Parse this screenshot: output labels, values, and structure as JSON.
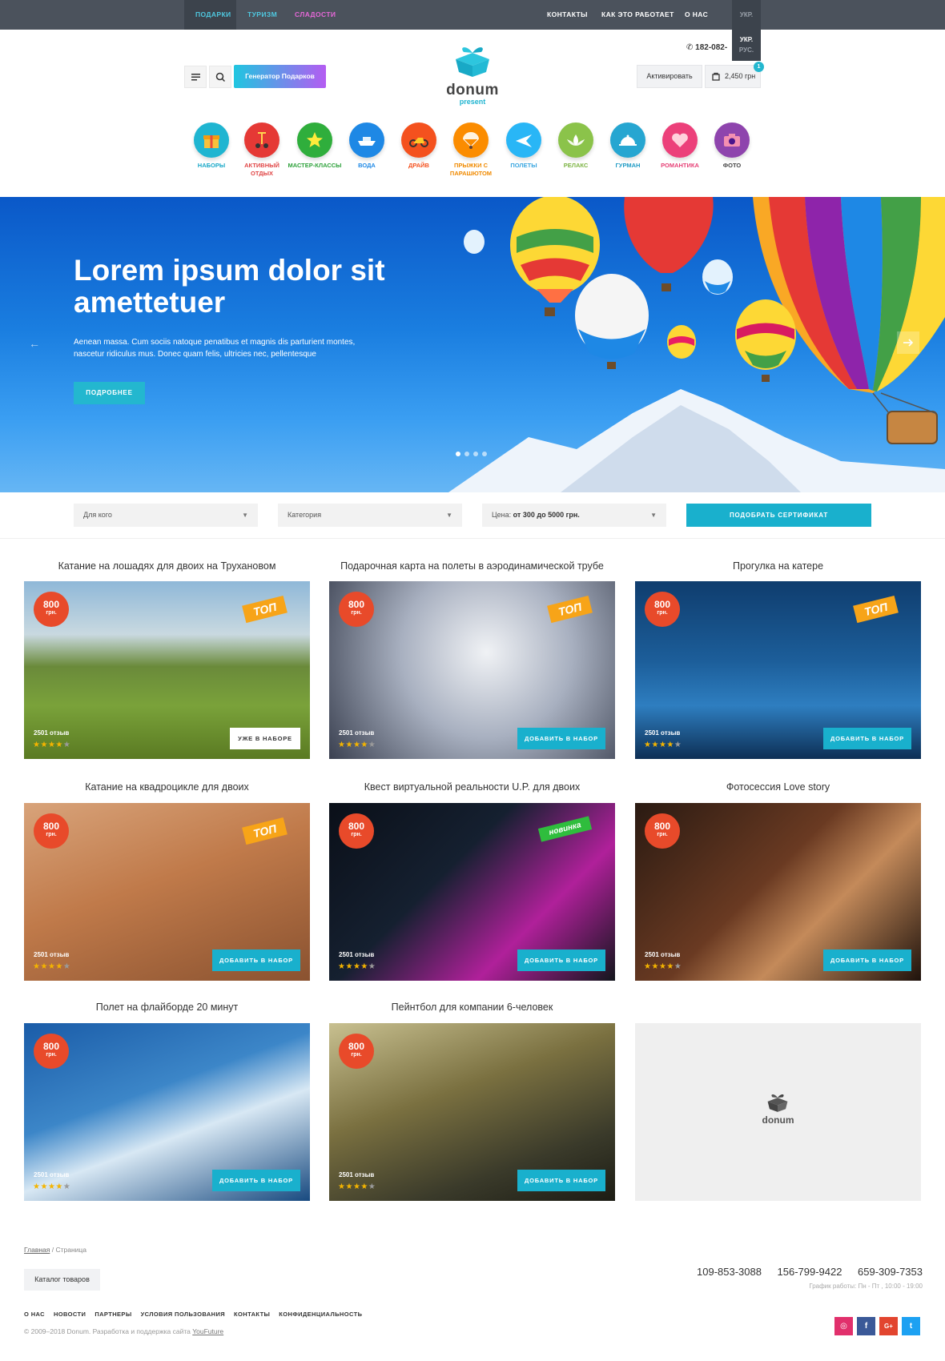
{
  "topnav": {
    "left": [
      "ПОДАРКИ",
      "ТУРИЗМ",
      "СЛАДОСТИ"
    ],
    "right": [
      "КОНТАКТЫ",
      "КАК ЭТО РАБОТАЕТ",
      "О НАС"
    ],
    "lang_current": "УКР.",
    "lang_options": [
      "УКР.",
      "РУС."
    ],
    "colors": {
      "bar": "#4b525c",
      "gifts": "#4fc8e0",
      "tourism": "#4fc8e0",
      "sweets": "#e668d8"
    }
  },
  "header": {
    "generator_label": "Генератор Подарков",
    "logo_word": "donum",
    "logo_sub": "present",
    "phone": "182-082-",
    "activate_label": "Активировать",
    "cart_total": "2,450 грн",
    "cart_count": "1"
  },
  "categories": [
    {
      "label": "НАБОРЫ",
      "color": "#1fb5d1",
      "text_color": "#19a8c8",
      "icon": "gift-icon"
    },
    {
      "label": "АКТИВНЫЙ ОТДЫХ",
      "color": "#e53935",
      "text_color": "#e04545",
      "icon": "segway-icon"
    },
    {
      "label": "МАСТЕР-КЛАССЫ",
      "color": "#2fae3c",
      "text_color": "#2fa23c",
      "icon": "star-icon"
    },
    {
      "label": "ВОДА",
      "color": "#1e88e5",
      "text_color": "#1e88e5",
      "icon": "boat-icon"
    },
    {
      "label": "ДРАЙВ",
      "color": "#f4511e",
      "text_color": "#f4511e",
      "icon": "motorbike-icon"
    },
    {
      "label": "ПРЫЖКИ С ПАРАШЮТОМ",
      "color": "#fb8c00",
      "text_color": "#f08a00",
      "icon": "parachute-icon"
    },
    {
      "label": "ПОЛЕТЫ",
      "color": "#29b6f6",
      "text_color": "#3aa6e0",
      "icon": "plane-icon"
    },
    {
      "label": "РЕЛАКС",
      "color": "#8bc34a",
      "text_color": "#7cb342",
      "icon": "lotus-icon"
    },
    {
      "label": "ГУРМАН",
      "color": "#26a6d1",
      "text_color": "#1e9ac4",
      "icon": "cloche-icon"
    },
    {
      "label": "РОМАНТИКА",
      "color": "#ec407a",
      "text_color": "#e64076",
      "icon": "heart-icon"
    },
    {
      "label": "ФОТО",
      "color": "#8e44ad",
      "text_color": "#444444",
      "icon": "camera-icon"
    }
  ],
  "hero": {
    "title": "Lorem ipsum dolor sit amettetuer",
    "text": "Aenean massa. Cum sociis natoque penatibus et magnis dis parturient montes, nascetur ridiculus mus. Donec quam felis, ultricies nec, pellentesque",
    "button": "ПОДРОБНЕЕ",
    "slides": 4,
    "active_slide": 1
  },
  "filters": {
    "who": "Для кого",
    "category": "Категория",
    "price_label": "Цена:",
    "price_value": "от 300 до 5000 грн.",
    "submit": "ПОДОБРАТЬ СЕРТИФИКАТ"
  },
  "products": [
    {
      "title": "Катание на лошадях для двоих на Трухановом",
      "price": "800",
      "currency": "грн.",
      "tag": "ТОП",
      "tag_type": "top",
      "reviews": "2501 отзыв",
      "rating": 4,
      "button": "УЖЕ В НАБОРЕ",
      "in_set": true,
      "scene": "horses"
    },
    {
      "title": "Подарочная карта на полеты в аэродинамической трубе",
      "price": "800",
      "currency": "грн.",
      "tag": "ТОП",
      "tag_type": "top",
      "reviews": "2501 отзыв",
      "rating": 4,
      "button": "ДОБАВИТЬ В НАБОР",
      "in_set": false,
      "scene": "tunnel"
    },
    {
      "title": "Прогулка на катере",
      "price": "800",
      "currency": "грн.",
      "tag": "ТОП",
      "tag_type": "top",
      "reviews": "2501 отзыв",
      "rating": 4,
      "button": "ДОБАВИТЬ В НАБОР",
      "in_set": false,
      "scene": "boat"
    },
    {
      "title": "Катание на квадроцикле для двоих",
      "price": "800",
      "currency": "грн.",
      "tag": "ТОП",
      "tag_type": "top",
      "reviews": "2501 отзыв",
      "rating": 4,
      "button": "ДОБАВИТЬ В НАБОР",
      "in_set": false,
      "scene": "quad"
    },
    {
      "title": "Квест виртуальной реальности U.P. для двоих",
      "price": "800",
      "currency": "грн.",
      "tag": "НОВИНКА",
      "tag_type": "new",
      "reviews": "2501 отзыв",
      "rating": 4,
      "button": "ДОБАВИТЬ В НАБОР",
      "in_set": false,
      "scene": "vr"
    },
    {
      "title": "Фотосессия Love story",
      "price": "800",
      "currency": "грн.",
      "tag": "",
      "tag_type": "",
      "reviews": "2501 отзыв",
      "rating": 4,
      "button": "ДОБАВИТЬ В НАБОР",
      "in_set": false,
      "scene": "couple"
    },
    {
      "title": "Полет на флайборде 20 минут",
      "price": "800",
      "currency": "грн.",
      "tag": "",
      "tag_type": "",
      "reviews": "2501 отзыв",
      "rating": 4,
      "button": "ДОБАВИТЬ В НАБОР",
      "in_set": false,
      "scene": "flyboard"
    },
    {
      "title": "Пейнтбол для компании 6-человек",
      "price": "800",
      "currency": "грн.",
      "tag": "",
      "tag_type": "",
      "reviews": "2501 отзыв",
      "rating": 4,
      "button": "ДОБАВИТЬ В НАБОР",
      "in_set": false,
      "scene": "paintball"
    }
  ],
  "placeholder_logo": "donum",
  "footer": {
    "breadcrumb_home": "Главная",
    "breadcrumb_sep": " / ",
    "breadcrumb_current": "Страница",
    "catalog": "Каталог товаров",
    "phones": [
      "109-853-3088",
      "156-799-9422",
      "659-309-7353"
    ],
    "hours": "График работы: Пн - Пт , 10:00 - 19:00",
    "links": [
      "О НАС",
      "НОВОСТИ",
      "ПАРТНЕРЫ",
      "УСЛОВИЯ ПОЛЬЗОВАНИЯ",
      "КОНТАКТЫ",
      "КОНФИДЕНЦИАЛЬНОСТЬ"
    ],
    "copyright": "© 2009–2018 Donum. Разработка и поддержка сайта ",
    "copyright_link": "YouFuture",
    "socials": [
      {
        "name": "instagram",
        "glyph": "◎",
        "color": "#e1306c"
      },
      {
        "name": "facebook",
        "glyph": "f",
        "color": "#3b5998"
      },
      {
        "name": "google-plus",
        "glyph": "G+",
        "color": "#e2452f"
      },
      {
        "name": "twitter",
        "glyph": "t",
        "color": "#1da1f2"
      }
    ]
  }
}
